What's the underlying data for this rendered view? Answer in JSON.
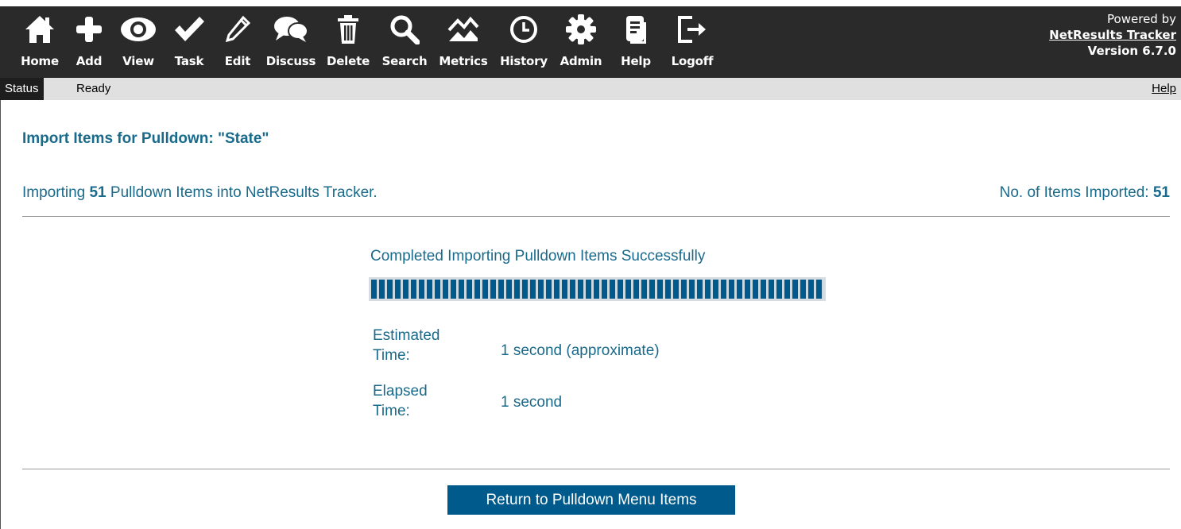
{
  "toolbar": {
    "items": [
      {
        "label": "Home",
        "icon": "home-icon"
      },
      {
        "label": "Add",
        "icon": "plus-icon"
      },
      {
        "label": "View",
        "icon": "eye-icon"
      },
      {
        "label": "Task",
        "icon": "check-icon"
      },
      {
        "label": "Edit",
        "icon": "pencil-icon"
      },
      {
        "label": "Discuss",
        "icon": "chat-bubbles-icon"
      },
      {
        "label": "Delete",
        "icon": "trash-icon"
      },
      {
        "label": "Search",
        "icon": "magnifier-icon"
      },
      {
        "label": "Metrics",
        "icon": "line-chart-icon"
      },
      {
        "label": "History",
        "icon": "clock-icon"
      },
      {
        "label": "Admin",
        "icon": "gear-icon"
      },
      {
        "label": "Help",
        "icon": "document-icon"
      },
      {
        "label": "Logoff",
        "icon": "logout-icon"
      }
    ]
  },
  "brand": {
    "powered_by": "Powered by",
    "product_link": "NetResults Tracker",
    "version": "Version 6.7.0"
  },
  "status": {
    "key": "Status",
    "value": "Ready",
    "help": "Help"
  },
  "main": {
    "title": "Import Items for Pulldown: \"State\"",
    "importing_prefix": "Importing",
    "importing_count": "51",
    "importing_suffix": "Pulldown Items into NetResults Tracker.",
    "imported_label": "No. of Items Imported:",
    "imported_count": "51",
    "completed_message": "Completed Importing Pulldown Items Successfully",
    "progress_fraction": 1.0,
    "estimated_label_1": "Estimated",
    "estimated_label_2": "Time:",
    "estimated_value": "1 second (approximate)",
    "elapsed_label_1": "Elapsed",
    "elapsed_label_2": "Time:",
    "elapsed_value": "1 second",
    "return_button": "Return to Pulldown Menu Items"
  },
  "colors": {
    "accent": "#005a8c",
    "text": "#1a6a8c",
    "toolbar_bg": "#2a2a2a"
  }
}
